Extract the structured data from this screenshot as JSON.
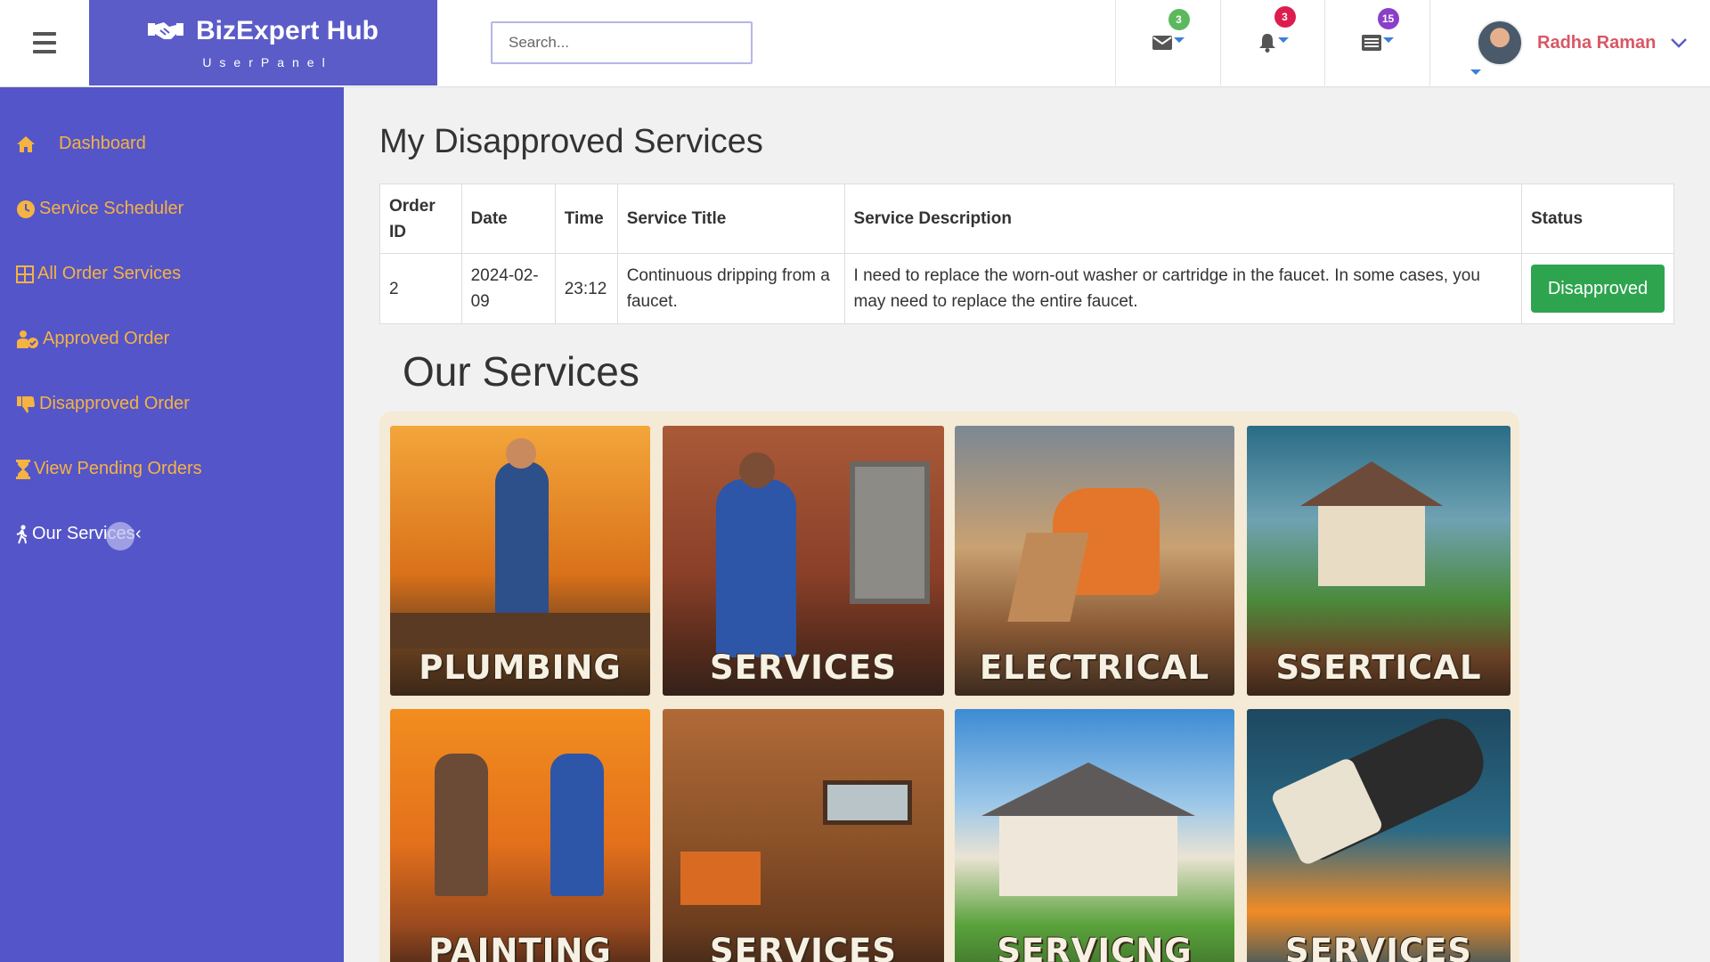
{
  "header": {
    "brand_title": "BizExpert Hub",
    "brand_subtitle": "UserPanel",
    "search_placeholder": "Search...",
    "messages_count": "3",
    "notifications_count": "3",
    "tasks_count": "15",
    "user_name": "Radha Raman"
  },
  "sidebar": {
    "items": [
      {
        "label": "Dashboard",
        "icon": "home-icon"
      },
      {
        "label": "Service Scheduler",
        "icon": "clock-icon"
      },
      {
        "label": "All Order Services",
        "icon": "table-icon"
      },
      {
        "label": "Approved Order",
        "icon": "user-check-icon"
      },
      {
        "label": "Disapproved Order",
        "icon": "thumbs-down-icon"
      },
      {
        "label": "View Pending Orders",
        "icon": "hourglass-icon"
      },
      {
        "label": "Our Services",
        "icon": "walking-icon"
      }
    ],
    "active_index": 6
  },
  "main": {
    "title": "My Disapproved Services",
    "table": {
      "headers": [
        "Order ID",
        "Date",
        "Time",
        "Service Title",
        "Service Description",
        "Status"
      ],
      "rows": [
        {
          "order_id": "2",
          "date": "2024-02-09",
          "time": "23:12",
          "service_title": "Continuous dripping from a faucet.",
          "service_description": "I need to replace the worn-out washer or cartridge in the faucet. In some cases, you may need to replace the entire faucet.",
          "status": "Disapproved"
        }
      ]
    },
    "services_title": "Our Services",
    "service_tiles": [
      "PLUMBING",
      "SERVICES",
      "ELECTRICAL",
      "SSERTICAL",
      "PAINTING",
      "SERVICES",
      "SERVICNG",
      "SERVICES"
    ]
  },
  "colors": {
    "brand": "#5b5cc8",
    "sidebar": "#5455c8",
    "sidebar_text": "#f5b342",
    "status_button": "#2ea44f",
    "user_name": "#d95764"
  }
}
